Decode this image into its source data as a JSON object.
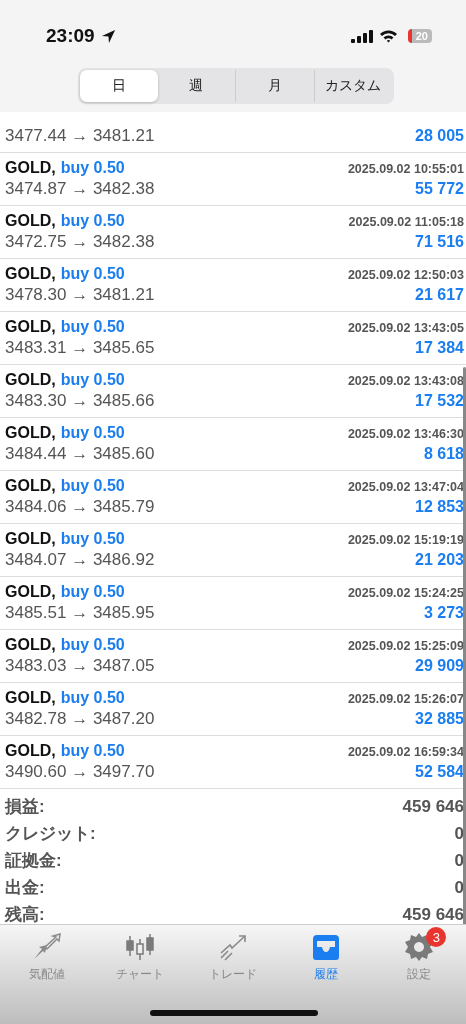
{
  "status_bar": {
    "time": "23:09",
    "battery": "20"
  },
  "period_tabs": [
    {
      "label": "日",
      "selected": true
    },
    {
      "label": "週",
      "selected": false
    },
    {
      "label": "月",
      "selected": false
    },
    {
      "label": "カスタム",
      "selected": false
    }
  ],
  "deals": [
    {
      "kind": "partial",
      "prices": "3477.44 → 3481.21",
      "profit": "28 005"
    },
    {
      "kind": "full",
      "symbol": "GOLD,",
      "side": "buy 0.50",
      "time": "2025.09.02 10:55:01",
      "prices": "3474.87 → 3482.38",
      "profit": "55 772"
    },
    {
      "kind": "full",
      "symbol": "GOLD,",
      "side": "buy 0.50",
      "time": "2025.09.02 11:05:18",
      "prices": "3472.75 → 3482.38",
      "profit": "71 516"
    },
    {
      "kind": "full",
      "symbol": "GOLD,",
      "side": "buy 0.50",
      "time": "2025.09.02 12:50:03",
      "prices": "3478.30 → 3481.21",
      "profit": "21 617"
    },
    {
      "kind": "full",
      "symbol": "GOLD,",
      "side": "buy 0.50",
      "time": "2025.09.02 13:43:05",
      "prices": "3483.31 → 3485.65",
      "profit": "17 384"
    },
    {
      "kind": "full",
      "symbol": "GOLD,",
      "side": "buy 0.50",
      "time": "2025.09.02 13:43:08",
      "prices": "3483.30 → 3485.66",
      "profit": "17 532"
    },
    {
      "kind": "full",
      "symbol": "GOLD,",
      "side": "buy 0.50",
      "time": "2025.09.02 13:46:30",
      "prices": "3484.44 → 3485.60",
      "profit": "8 618"
    },
    {
      "kind": "full",
      "symbol": "GOLD,",
      "side": "buy 0.50",
      "time": "2025.09.02 13:47:04",
      "prices": "3484.06 → 3485.79",
      "profit": "12 853"
    },
    {
      "kind": "full",
      "symbol": "GOLD,",
      "side": "buy 0.50",
      "time": "2025.09.02 15:19:19",
      "prices": "3484.07 → 3486.92",
      "profit": "21 203"
    },
    {
      "kind": "full",
      "symbol": "GOLD,",
      "side": "buy 0.50",
      "time": "2025.09.02 15:24:25",
      "prices": "3485.51 → 3485.95",
      "profit": "3 273"
    },
    {
      "kind": "full",
      "symbol": "GOLD,",
      "side": "buy 0.50",
      "time": "2025.09.02 15:25:09",
      "prices": "3483.03 → 3487.05",
      "profit": "29 909"
    },
    {
      "kind": "full",
      "symbol": "GOLD,",
      "side": "buy 0.50",
      "time": "2025.09.02 15:26:07",
      "prices": "3482.78 → 3487.20",
      "profit": "32 885"
    },
    {
      "kind": "full",
      "symbol": "GOLD,",
      "side": "buy 0.50",
      "time": "2025.09.02 16:59:34",
      "prices": "3490.60 → 3497.70",
      "profit": "52 584"
    }
  ],
  "summary": [
    {
      "label": "損益:",
      "value": "459 646"
    },
    {
      "label": "クレジット:",
      "value": "0"
    },
    {
      "label": "証拠金:",
      "value": "0"
    },
    {
      "label": "出金:",
      "value": "0"
    },
    {
      "label": "残高:",
      "value": "459 646"
    }
  ],
  "tab_bar": [
    {
      "kind": "quotes",
      "label": "気配値",
      "selected": false
    },
    {
      "kind": "chart",
      "label": "チャート",
      "selected": false
    },
    {
      "kind": "trade",
      "label": "トレード",
      "selected": false
    },
    {
      "kind": "history",
      "label": "履歴",
      "selected": true
    },
    {
      "kind": "settings",
      "label": "設定",
      "selected": false,
      "badge": "3"
    }
  ]
}
